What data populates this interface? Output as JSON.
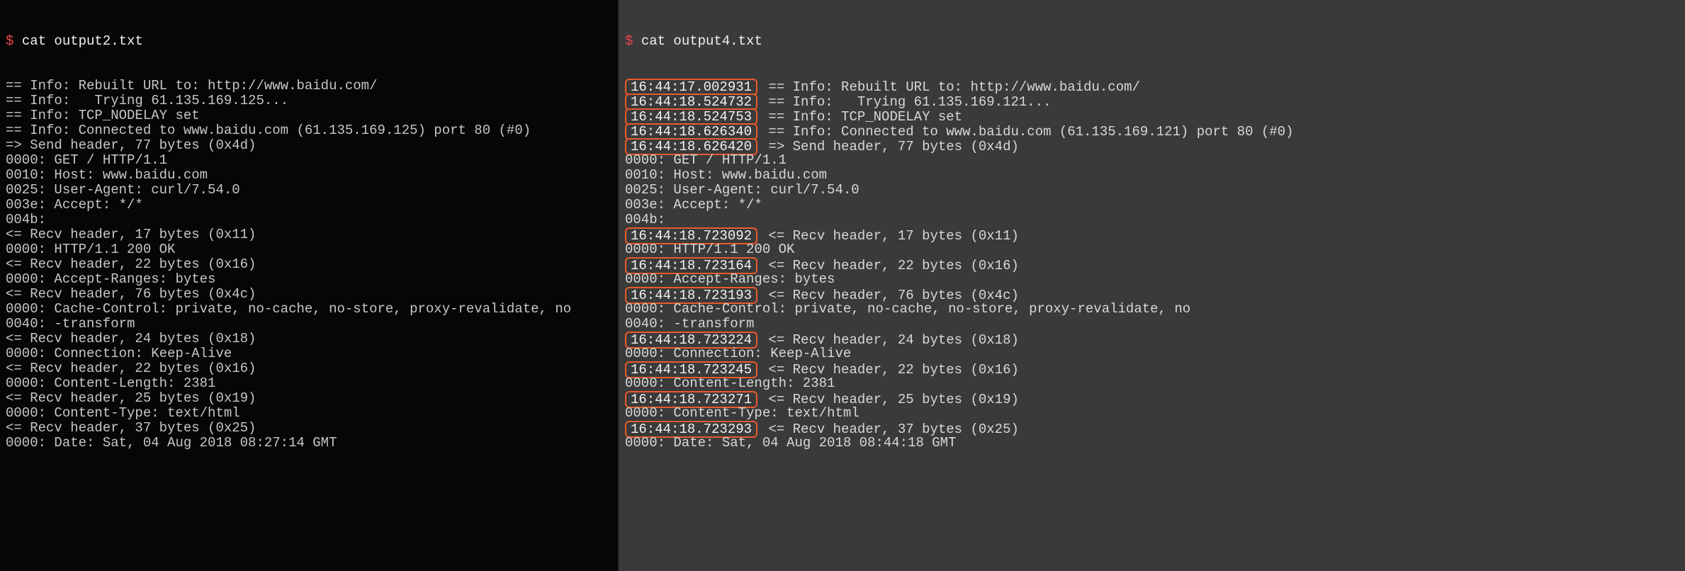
{
  "prompt_symbol": "$",
  "left": {
    "command": "cat output2.txt",
    "lines": [
      "== Info: Rebuilt URL to: http://www.baidu.com/",
      "== Info:   Trying 61.135.169.125...",
      "== Info: TCP_NODELAY set",
      "== Info: Connected to www.baidu.com (61.135.169.125) port 80 (#0)",
      "=> Send header, 77 bytes (0x4d)",
      "0000: GET / HTTP/1.1",
      "0010: Host: www.baidu.com",
      "0025: User-Agent: curl/7.54.0",
      "003e: Accept: */*",
      "004b:",
      "<= Recv header, 17 bytes (0x11)",
      "0000: HTTP/1.1 200 OK",
      "<= Recv header, 22 bytes (0x16)",
      "0000: Accept-Ranges: bytes",
      "<= Recv header, 76 bytes (0x4c)",
      "0000: Cache-Control: private, no-cache, no-store, proxy-revalidate, no",
      "0040: -transform",
      "<= Recv header, 24 bytes (0x18)",
      "0000: Connection: Keep-Alive",
      "<= Recv header, 22 bytes (0x16)",
      "0000: Content-Length: 2381",
      "<= Recv header, 25 bytes (0x19)",
      "0000: Content-Type: text/html",
      "<= Recv header, 37 bytes (0x25)",
      "0000: Date: Sat, 04 Aug 2018 08:27:14 GMT"
    ]
  },
  "right": {
    "command": "cat output4.txt",
    "lines": [
      {
        "ts": "16:44:17.002931",
        "text": "== Info: Rebuilt URL to: http://www.baidu.com/"
      },
      {
        "ts": "16:44:18.524732",
        "text": "== Info:   Trying 61.135.169.121..."
      },
      {
        "ts": "16:44:18.524753",
        "text": "== Info: TCP_NODELAY set"
      },
      {
        "ts": "16:44:18.626340",
        "text": "== Info: Connected to www.baidu.com (61.135.169.121) port 80 (#0)"
      },
      {
        "ts": "16:44:18.626420",
        "text": "=> Send header, 77 bytes (0x4d)"
      },
      {
        "text": "0000: GET / HTTP/1.1"
      },
      {
        "text": "0010: Host: www.baidu.com"
      },
      {
        "text": "0025: User-Agent: curl/7.54.0"
      },
      {
        "text": "003e: Accept: */*"
      },
      {
        "text": "004b:"
      },
      {
        "ts": "16:44:18.723092",
        "text": "<= Recv header, 17 bytes (0x11)"
      },
      {
        "text": "0000: HTTP/1.1 200 OK"
      },
      {
        "ts": "16:44:18.723164",
        "text": "<= Recv header, 22 bytes (0x16)"
      },
      {
        "text": "0000: Accept-Ranges: bytes"
      },
      {
        "ts": "16:44:18.723193",
        "text": "<= Recv header, 76 bytes (0x4c)"
      },
      {
        "text": "0000: Cache-Control: private, no-cache, no-store, proxy-revalidate, no"
      },
      {
        "text": "0040: -transform"
      },
      {
        "ts": "16:44:18.723224",
        "text": "<= Recv header, 24 bytes (0x18)"
      },
      {
        "text": "0000: Connection: Keep-Alive"
      },
      {
        "ts": "16:44:18.723245",
        "text": "<= Recv header, 22 bytes (0x16)"
      },
      {
        "text": "0000: Content-Length: 2381"
      },
      {
        "ts": "16:44:18.723271",
        "text": "<= Recv header, 25 bytes (0x19)"
      },
      {
        "text": "0000: Content-Type: text/html"
      },
      {
        "ts": "16:44:18.723293",
        "text": "<= Recv header, 37 bytes (0x25)"
      },
      {
        "text": "0000: Date: Sat, 04 Aug 2018 08:44:18 GMT"
      }
    ]
  }
}
